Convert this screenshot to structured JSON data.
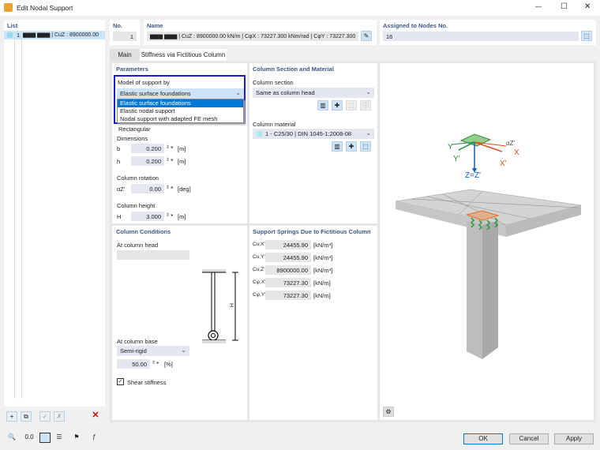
{
  "window": {
    "title": "Edit Nodal Support",
    "minimize": "—",
    "maximize": "☐",
    "close": "✕"
  },
  "list": {
    "header": "List",
    "items": [
      {
        "no": "1",
        "text": "▆▆▆ ▆▆▆ | CuZ : 8900000.00",
        "color": "#9ad7f0"
      }
    ]
  },
  "no": {
    "label": "No.",
    "value": "1"
  },
  "name": {
    "label": "Name",
    "value": "▆▆▆ ▆▆▆ | CuZ : 8900000.00 kN/m | CφX : 73227.300 kNm/rad | CφY : 73227.300"
  },
  "assigned": {
    "label": "Assigned to Nodes No.",
    "value": "16"
  },
  "tabs": [
    {
      "label": "Main"
    },
    {
      "label": "Stiffness via Fictitious Column"
    }
  ],
  "parameters": {
    "header": "Parameters",
    "model_label": "Model of support by",
    "model_value": "Elastic surface foundations",
    "options": [
      "Elastic surface foundations",
      "Elastic nodal support",
      "Nodal support with adapted FE mesh"
    ],
    "hidden_text": "Rectangular",
    "dimensions_label": "Dimensions",
    "b_label": "b",
    "b_value": "0.200",
    "h_label": "h",
    "h_value": "0.200",
    "unit_m": "[m]",
    "rotation_label": "Column rotation",
    "alpha_label": "αZ'",
    "alpha_value": "0.00",
    "unit_deg": "[deg]",
    "height_label": "Column height",
    "H_label": "H",
    "H_value": "3.000"
  },
  "section": {
    "header": "Column Section and Material",
    "section_label": "Column section",
    "section_value": "Same as column head",
    "material_label": "Column material",
    "material_value": "1 - C25/30 | DIN 1045-1:2008-08",
    "material_color": "#a8ecf2"
  },
  "conditions": {
    "header": "Column Conditions",
    "head_label": "At column head",
    "base_label": "At column base",
    "base_value": "Semi-rigid",
    "percent_value": "50.00",
    "percent_unit": "[%]",
    "shear_label": "Shear stiffness",
    "shear_checked": true,
    "diagram_H": "H"
  },
  "springs": {
    "header": "Support Springs Due to Fictitious Column",
    "rows": [
      {
        "label": "Cu,X'",
        "value": "24455.90",
        "unit": "[kN/m³]"
      },
      {
        "label": "Cu,Y'",
        "value": "24455.90",
        "unit": "[kN/m³]"
      },
      {
        "label": "Cu,Z'",
        "value": "8900000.00",
        "unit": "[kN/m³]"
      },
      {
        "label": "Cφ,X'",
        "value": "73227.30",
        "unit": "[kN/m]"
      },
      {
        "label": "Cφ,Y'",
        "value": "73227.30",
        "unit": "[kN/m]"
      }
    ]
  },
  "graphic": {
    "axes": {
      "z": "Z=Z'",
      "x": "X",
      "xp": "X'",
      "y": "Y",
      "yp": "Y'",
      "alpha": "αZ'"
    }
  },
  "buttons": {
    "ok": "OK",
    "cancel": "Cancel",
    "apply": "Apply"
  }
}
